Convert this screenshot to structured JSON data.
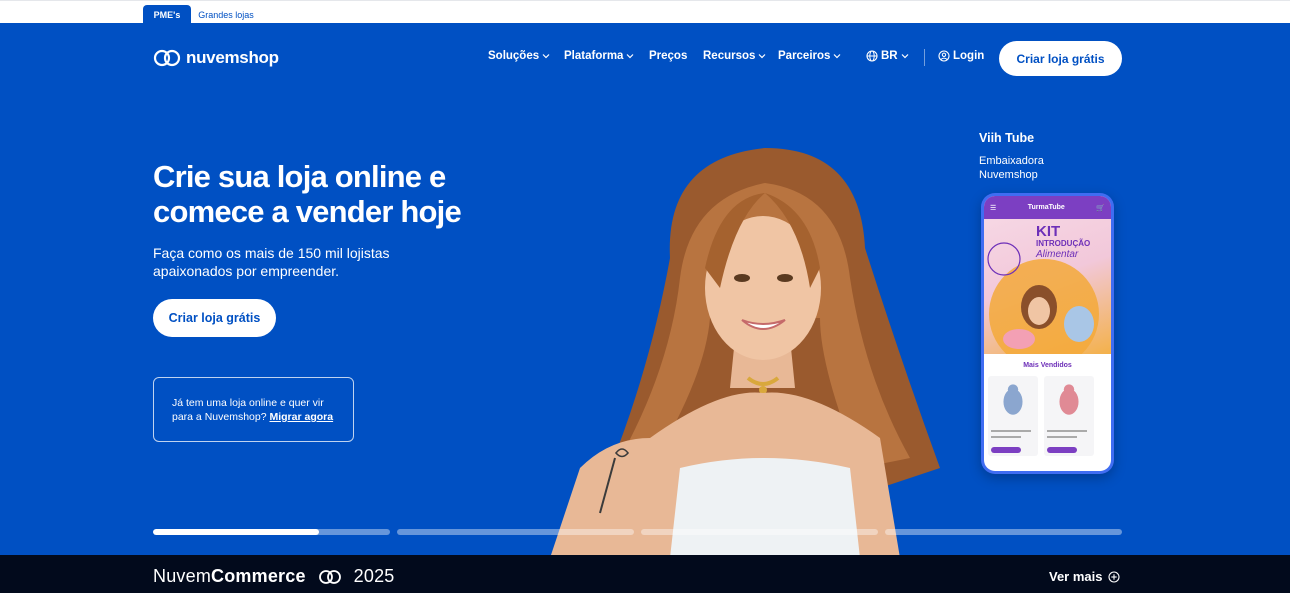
{
  "segment_tabs": [
    {
      "label": "PME's",
      "active": true
    },
    {
      "label": "Grandes lojas",
      "active": false
    }
  ],
  "brand": {
    "name": "nuvemshop"
  },
  "nav": {
    "items": [
      {
        "label": "Soluções",
        "dropdown": true
      },
      {
        "label": "Plataforma",
        "dropdown": true
      },
      {
        "label": "Preços",
        "dropdown": false
      },
      {
        "label": "Recursos",
        "dropdown": true
      },
      {
        "label": "Parceiros",
        "dropdown": true
      }
    ],
    "country": "BR",
    "login": "Login",
    "cta": "Criar loja grátis"
  },
  "hero": {
    "title": "Crie sua loja online e comece a vender hoje",
    "subtitle": "Faça como os mais de 150 mil lojistas apaixonados por empreender.",
    "cta": "Criar loja grátis",
    "migrate_text": "Já tem uma loja online e quer vir para a Nuvemshop?",
    "migrate_link": "Migrar agora"
  },
  "ambassador": {
    "name": "Viih Tube",
    "role": "Embaixadora Nuvemshop"
  },
  "phone": {
    "store": "TurmaTube",
    "banner_line1": "KIT",
    "banner_line2": "INTRODUÇÃO",
    "banner_line3": "Alimentar",
    "section_title": "Mais Vendidos"
  },
  "carousel": {
    "slides": 4,
    "active_index": 0,
    "active_progress": 0.7
  },
  "bottom_banner": {
    "title_light": "Nuvem",
    "title_bold": "Commerce",
    "year": "2025",
    "link": "Ver mais"
  },
  "colors": {
    "primary": "#0050c3",
    "dark": "#020a1c",
    "white": "#ffffff"
  }
}
